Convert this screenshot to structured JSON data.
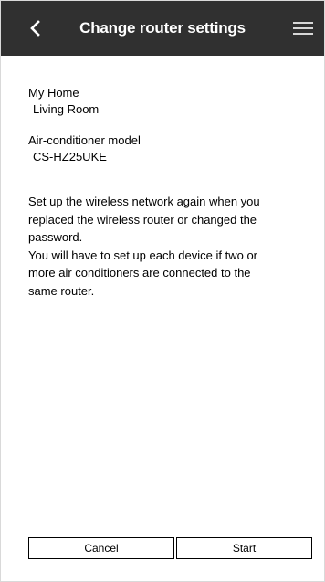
{
  "header": {
    "title": "Change router settings",
    "back_icon": "chevron-left-icon",
    "menu_icon": "hamburger-menu-icon",
    "background": "#303030"
  },
  "location": {
    "home": "My Home",
    "room": "Living Room"
  },
  "model": {
    "label": "Air-conditioner model",
    "value": "CS-HZ25UKE"
  },
  "instructions": {
    "lines": [
      "Set up the wireless network again when you",
      "replaced the wireless router or changed the",
      "password.",
      "You will have to set up each device if two or",
      "more air conditioners are connected to the",
      "same router."
    ]
  },
  "buttons": {
    "cancel": "Cancel",
    "start": "Start"
  }
}
